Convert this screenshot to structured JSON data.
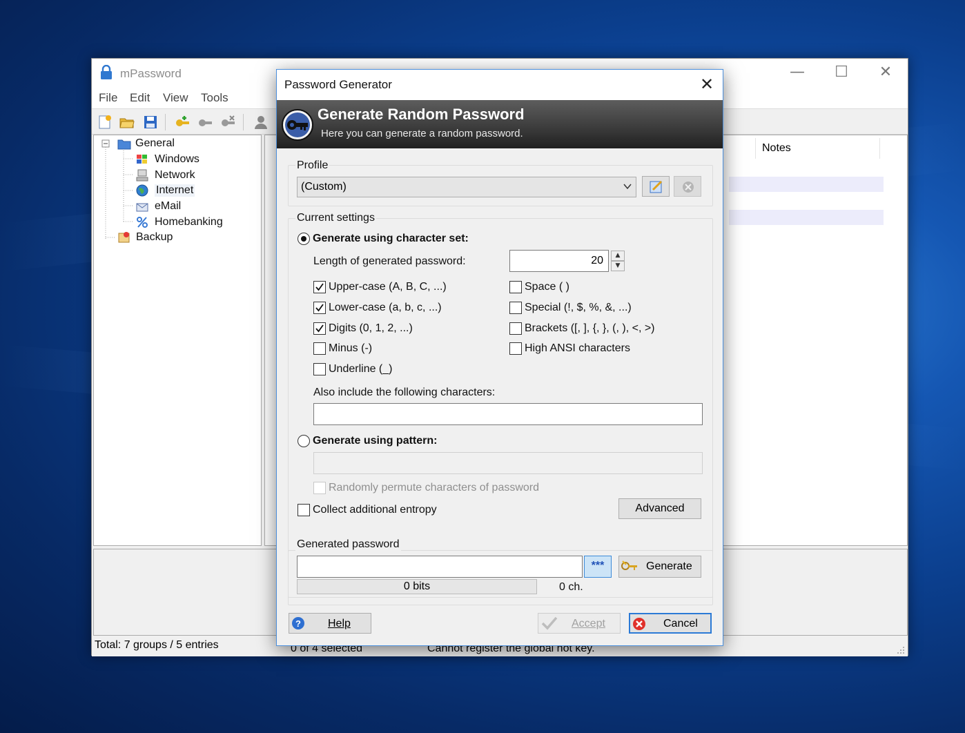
{
  "main_window": {
    "title": "mPassword",
    "menu": [
      "File",
      "Edit",
      "View",
      "Tools"
    ],
    "tree": {
      "root": "General",
      "children": [
        "Windows",
        "Network",
        "Internet",
        "eMail",
        "Homebanking"
      ],
      "sibling": "Backup"
    },
    "list": {
      "column_notes": "Notes"
    },
    "status": {
      "totals": "Total: 7 groups / 5 entries",
      "selected": "0 of 4 selected",
      "message": "Cannot register the global hot key."
    }
  },
  "dialog": {
    "title": "Password Generator",
    "banner_title": "Generate Random Password",
    "banner_subtitle": "Here you can generate a random password.",
    "profile_label": "Profile",
    "profile_value": "(Custom)",
    "current_settings_label": "Current settings",
    "charset_radio_label": "Generate using character set:",
    "length_label": "Length of generated password:",
    "length_value": "20",
    "charsets_left": [
      {
        "label": "Upper-case (A, B, C, ...)",
        "checked": true
      },
      {
        "label": "Lower-case (a, b, c, ...)",
        "checked": true
      },
      {
        "label": "Digits (0, 1, 2, ...)",
        "checked": true
      },
      {
        "label": "Minus (-)",
        "checked": false
      },
      {
        "label": "Underline (_)",
        "checked": false
      }
    ],
    "charsets_right": [
      {
        "label": "Space ( )",
        "checked": false
      },
      {
        "label": "Special (!, $, %, &, ...)",
        "checked": false
      },
      {
        "label": "Brackets ([, ], {, }, (, ), <, >)",
        "checked": false
      },
      {
        "label": "High ANSI characters",
        "checked": false
      }
    ],
    "also_include_label": "Also include the following characters:",
    "also_include_value": "",
    "pattern_radio_label": "Generate using pattern:",
    "pattern_value": "",
    "permute_label": "Randomly permute characters of password",
    "entropy_label": "Collect additional entropy",
    "advanced_button": "Advanced",
    "generated_password_label": "Generated password",
    "generated_password_value": "",
    "hide_toggle": "***",
    "generate_button": "Generate",
    "bits_text": "0 bits",
    "chars_text": "0 ch.",
    "help_button": "Help",
    "accept_button": "Accept",
    "cancel_button": "Cancel"
  },
  "colors": {
    "desktop_blue": "#0b3f8e",
    "dialog_border": "#4a8edc",
    "banner_dark": "#3a3a3a",
    "row_highlight": "#ececfb"
  }
}
